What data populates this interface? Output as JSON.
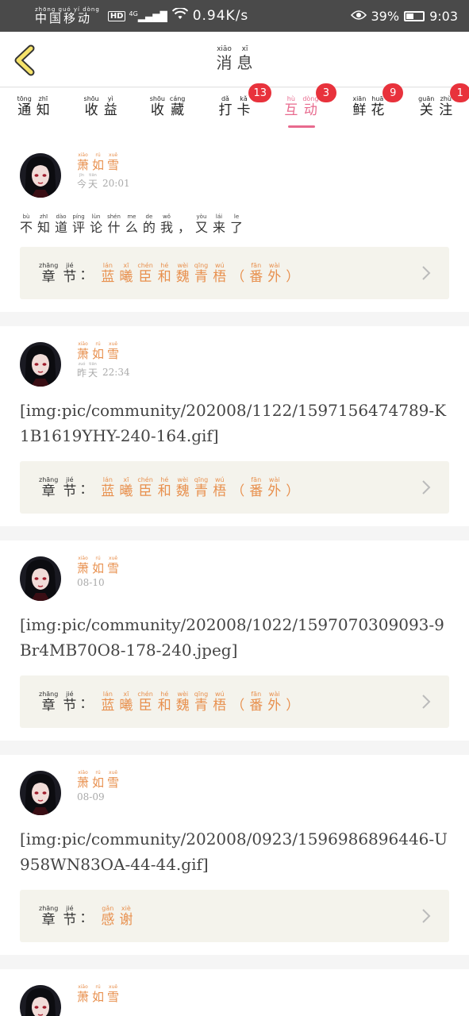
{
  "status_bar": {
    "carrier_pinyin": [
      "zhōng",
      "guó",
      "yí",
      "dòng"
    ],
    "carrier": [
      "中",
      "国",
      "移",
      "动"
    ],
    "hd": "HD",
    "network": "4G",
    "speed": "0.94K/s",
    "battery": "39%",
    "battery_level": 0.39,
    "time": "9:03"
  },
  "header": {
    "back_icon": "chevron-left-icon",
    "title": [
      {
        "p": "xiāo",
        "h": "消"
      },
      {
        "p": "xī",
        "h": "息"
      }
    ]
  },
  "tabs": [
    {
      "chars": [
        {
          "p": "tōng",
          "h": "通"
        },
        {
          "p": "zhī",
          "h": "知"
        }
      ],
      "badge": null,
      "active": false
    },
    {
      "chars": [
        {
          "p": "shōu",
          "h": "收"
        },
        {
          "p": "yì",
          "h": "益"
        }
      ],
      "badge": null,
      "active": false
    },
    {
      "chars": [
        {
          "p": "shōu",
          "h": "收"
        },
        {
          "p": "cáng",
          "h": "藏"
        }
      ],
      "badge": null,
      "active": false
    },
    {
      "chars": [
        {
          "p": "dǎ",
          "h": "打"
        },
        {
          "p": "kǎ",
          "h": "卡"
        }
      ],
      "badge": "13",
      "active": false
    },
    {
      "chars": [
        {
          "p": "hù",
          "h": "互"
        },
        {
          "p": "dòng",
          "h": "动"
        }
      ],
      "badge": "3",
      "active": true
    },
    {
      "chars": [
        {
          "p": "xiān",
          "h": "鲜"
        },
        {
          "p": "huā",
          "h": "花"
        }
      ],
      "badge": "9",
      "active": false
    },
    {
      "chars": [
        {
          "p": "guān",
          "h": "关"
        },
        {
          "p": "zhù",
          "h": "注"
        }
      ],
      "badge": "1",
      "active": false
    }
  ],
  "colors": {
    "accent": "#e86a8e",
    "orange": "#e8904e",
    "badge": "#e8323c"
  },
  "chapter_label": [
    {
      "p": "zhāng",
      "h": "章"
    },
    {
      "p": "jié",
      "h": "节"
    }
  ],
  "chapter_colon": "：",
  "messages": [
    {
      "user": [
        {
          "p": "xiāo",
          "h": "萧"
        },
        {
          "p": "rú",
          "h": "如"
        },
        {
          "p": "xuě",
          "h": "雪"
        }
      ],
      "day": [
        {
          "p": "jīn",
          "h": "今"
        },
        {
          "p": "tiān",
          "h": "天"
        }
      ],
      "time": "20:01",
      "text_ruby": [
        {
          "p": "bù",
          "h": "不"
        },
        {
          "p": "zhī",
          "h": "知"
        },
        {
          "p": "dào",
          "h": "道"
        },
        {
          "p": "píng",
          "h": "评"
        },
        {
          "p": "lùn",
          "h": "论"
        },
        {
          "p": "shén",
          "h": "什"
        },
        {
          "p": "me",
          "h": "么"
        },
        {
          "p": "de",
          "h": "的"
        },
        {
          "p": "wǒ",
          "h": "我"
        },
        {
          "p": "",
          "h": "，"
        },
        {
          "p": "yòu",
          "h": "又"
        },
        {
          "p": "lái",
          "h": "来"
        },
        {
          "p": "le",
          "h": "了"
        }
      ],
      "text": null,
      "chapter": [
        {
          "p": "lán",
          "h": "蓝"
        },
        {
          "p": "xī",
          "h": "曦"
        },
        {
          "p": "chén",
          "h": "臣"
        },
        {
          "p": "hé",
          "h": "和"
        },
        {
          "p": "wèi",
          "h": "魏"
        },
        {
          "p": "qīng",
          "h": "青"
        },
        {
          "p": "wú",
          "h": "梧"
        },
        {
          "p": "",
          "h": "（"
        },
        {
          "p": "fān",
          "h": "番"
        },
        {
          "p": "wài",
          "h": "外"
        },
        {
          "p": "",
          "h": "）"
        }
      ]
    },
    {
      "user": [
        {
          "p": "xiāo",
          "h": "萧"
        },
        {
          "p": "rú",
          "h": "如"
        },
        {
          "p": "xuě",
          "h": "雪"
        }
      ],
      "day": [
        {
          "p": "zuó",
          "h": "昨"
        },
        {
          "p": "tiān",
          "h": "天"
        }
      ],
      "time": "22:34",
      "text_ruby": null,
      "text": "[img:pic/community/202008/1122/1597156474789-K1B1619YHY-240-164.gif]",
      "chapter": [
        {
          "p": "lán",
          "h": "蓝"
        },
        {
          "p": "xī",
          "h": "曦"
        },
        {
          "p": "chén",
          "h": "臣"
        },
        {
          "p": "hé",
          "h": "和"
        },
        {
          "p": "wèi",
          "h": "魏"
        },
        {
          "p": "qīng",
          "h": "青"
        },
        {
          "p": "wú",
          "h": "梧"
        },
        {
          "p": "",
          "h": "（"
        },
        {
          "p": "fān",
          "h": "番"
        },
        {
          "p": "wài",
          "h": "外"
        },
        {
          "p": "",
          "h": "）"
        }
      ]
    },
    {
      "user": [
        {
          "p": "xiāo",
          "h": "萧"
        },
        {
          "p": "rú",
          "h": "如"
        },
        {
          "p": "xuě",
          "h": "雪"
        }
      ],
      "day": null,
      "time": "08-10",
      "text_ruby": null,
      "text": "[img:pic/community/202008/1022/1597070309093-9Br4MB70O8-178-240.jpeg]",
      "chapter": [
        {
          "p": "lán",
          "h": "蓝"
        },
        {
          "p": "xī",
          "h": "曦"
        },
        {
          "p": "chén",
          "h": "臣"
        },
        {
          "p": "hé",
          "h": "和"
        },
        {
          "p": "wèi",
          "h": "魏"
        },
        {
          "p": "qīng",
          "h": "青"
        },
        {
          "p": "wú",
          "h": "梧"
        },
        {
          "p": "",
          "h": "（"
        },
        {
          "p": "fān",
          "h": "番"
        },
        {
          "p": "wài",
          "h": "外"
        },
        {
          "p": "",
          "h": "）"
        }
      ]
    },
    {
      "user": [
        {
          "p": "xiāo",
          "h": "萧"
        },
        {
          "p": "rú",
          "h": "如"
        },
        {
          "p": "xuě",
          "h": "雪"
        }
      ],
      "day": null,
      "time": "08-09",
      "text_ruby": null,
      "text": "[img:pic/community/202008/0923/1596986896446-U958WN83OA-44-44.gif]",
      "chapter": [
        {
          "p": "gǎn",
          "h": "感"
        },
        {
          "p": "xiè",
          "h": "谢"
        }
      ]
    },
    {
      "user": [
        {
          "p": "xiāo",
          "h": "萧"
        },
        {
          "p": "rú",
          "h": "如"
        },
        {
          "p": "xuě",
          "h": "雪"
        }
      ],
      "day": null,
      "time": "",
      "text_ruby": null,
      "text": "",
      "chapter": []
    }
  ]
}
